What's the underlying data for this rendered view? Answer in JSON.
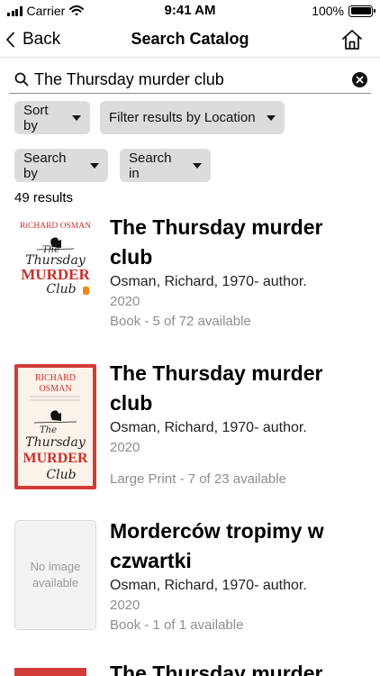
{
  "status": {
    "carrier": "Carrier",
    "time": "9:41 AM",
    "battery": "100%"
  },
  "nav": {
    "back_label": "Back",
    "title": "Search Catalog"
  },
  "search": {
    "query": "The Thursday murder club"
  },
  "filters": {
    "sort_by": "Sort by",
    "filter_location": "Filter results by Location",
    "search_by": "Search by",
    "search_in": "Search in"
  },
  "results_count": "49 results",
  "results": [
    {
      "title": "The Thursday murder club",
      "author": "Osman, Richard, 1970- author.",
      "year": "2020",
      "availability": "Book - 5 of 72 available",
      "cover": {
        "author_text": "RiCHARD OSMAN",
        "line1": "The",
        "line2": "Thursday",
        "line3": "MURDER",
        "line4": "Club"
      }
    },
    {
      "title": "The Thursday murder club",
      "author": "Osman, Richard, 1970- author.",
      "year": "2020",
      "availability": "Large Print - 7 of 23 available",
      "cover": {
        "author_line1": "RICHARD",
        "author_line2": "OSMAN",
        "line1": "The",
        "line2": "Thursday",
        "line3": "MURDER",
        "line4": "Club"
      }
    },
    {
      "title": "Morderców tropimy w czwartki",
      "author": "Osman, Richard, 1970- author.",
      "year": "2020",
      "availability": "Book - 1 of 1 available",
      "no_image": "No image available"
    },
    {
      "title": "The Thursday murder"
    }
  ]
}
